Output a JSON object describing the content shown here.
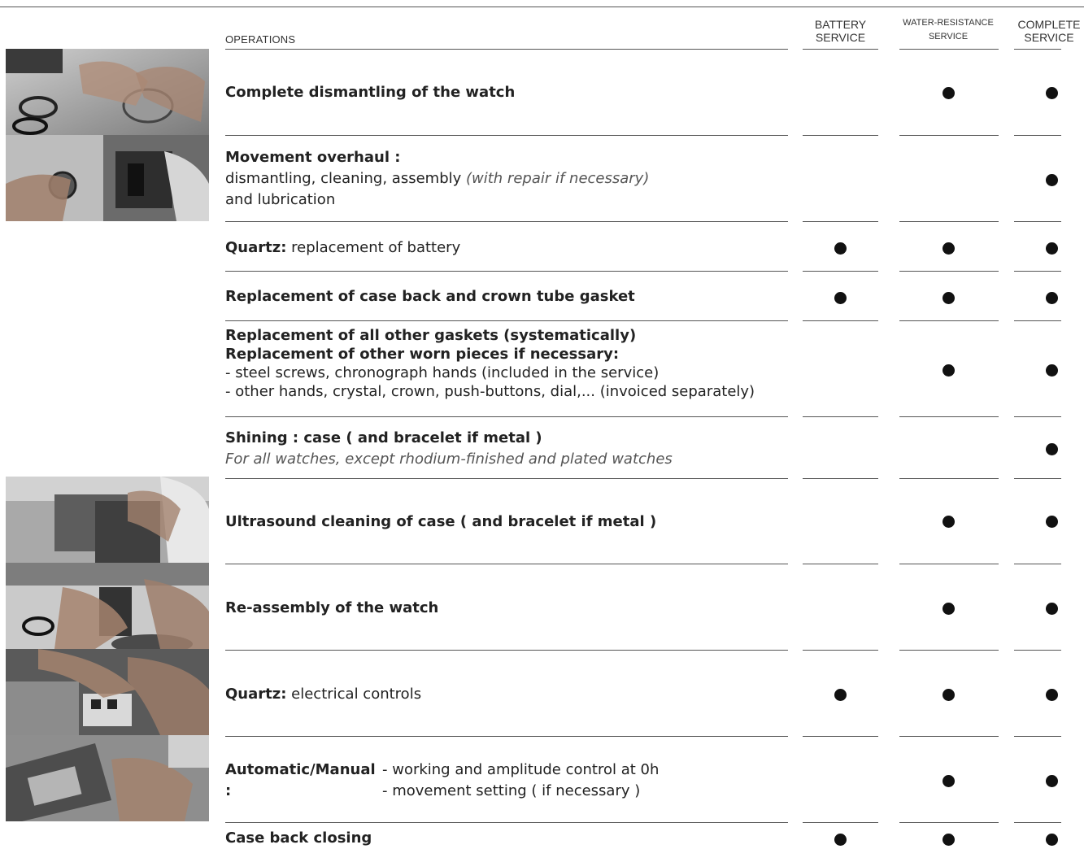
{
  "header": {
    "operations_label": "OPERATIONS",
    "columns": [
      {
        "line1": "BATTERY",
        "line2": "SERVICE"
      },
      {
        "line1": "WATER-RESISTANCE",
        "line2": "SERVICE"
      },
      {
        "line1": "COMPLETE",
        "line2": "SERVICE"
      }
    ]
  },
  "rows": [
    {
      "bold": "Complete dismantling of the watch",
      "battery": false,
      "water": true,
      "complete": true
    },
    {
      "bold": "Movement overhaul :",
      "line2a": "dismantling, cleaning, assembly ",
      "line2b": "(with repair if necessary)",
      "line3": "and lubrication",
      "battery": false,
      "water": false,
      "complete": true
    },
    {
      "bold": "Quartz:",
      "rest": " replacement of battery",
      "battery": true,
      "water": true,
      "complete": true
    },
    {
      "bold": "Replacement of case back and crown tube gasket",
      "battery": true,
      "water": true,
      "complete": true
    },
    {
      "bold1": "Replacement of all other gaskets (systematically)",
      "bold2": "Replacement of other worn pieces if necessary:",
      "line3": "- steel screws, chronograph hands (included in the service)",
      "line4": "- other hands, crystal, crown, push-buttons, dial,... (invoiced separately)",
      "battery": false,
      "water": true,
      "complete": true
    },
    {
      "bold": "Shining : case ( and bracelet if metal )",
      "italic": "For all watches, except rhodium-finished and plated watches",
      "battery": false,
      "water": false,
      "complete": true
    },
    {
      "bold": "Ultrasound cleaning of case ( and bracelet if metal )",
      "battery": false,
      "water": true,
      "complete": true
    },
    {
      "bold": "Re-assembly of the watch",
      "battery": false,
      "water": true,
      "complete": true
    },
    {
      "bold": "Quartz:",
      "rest": " electrical controls",
      "battery": true,
      "water": true,
      "complete": true
    },
    {
      "bold": "Automatic/Manual :",
      "sub1": "- working and amplitude control at 0h",
      "sub2": "- movement setting ( if necessary )",
      "battery": false,
      "water": true,
      "complete": true
    },
    {
      "bold": "Case back closing",
      "battery": true,
      "water": true,
      "complete": true
    }
  ]
}
